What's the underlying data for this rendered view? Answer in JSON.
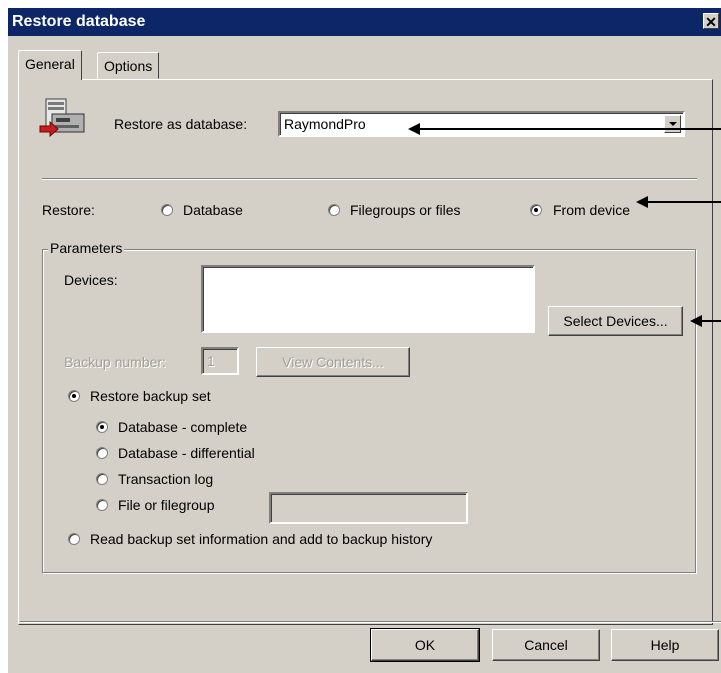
{
  "window": {
    "title": "Restore database",
    "close_glyph": "✕"
  },
  "tabs": [
    {
      "label": "General",
      "active": true
    },
    {
      "label": "Options",
      "active": false
    }
  ],
  "restore_as": {
    "icon": "database-server-icon",
    "label": "Restore as database:",
    "value": "RaymondPro"
  },
  "restore_mode": {
    "label": "Restore:",
    "options": [
      {
        "label": "Database",
        "selected": false
      },
      {
        "label": "Filegroups or files",
        "selected": false
      },
      {
        "label": "From device",
        "selected": true
      }
    ]
  },
  "parameters": {
    "legend": "Parameters",
    "devices_label": "Devices:",
    "select_devices_label": "Select Devices...",
    "backup_number_label": "Backup number:",
    "backup_number_value": "1",
    "view_contents_label": "View Contents...",
    "restore_backup_set_label": "Restore backup set",
    "backup_types": [
      {
        "label": "Database - complete",
        "selected": true
      },
      {
        "label": "Database - differential",
        "selected": false
      },
      {
        "label": "Transaction log",
        "selected": false
      },
      {
        "label": "File or filegroup",
        "selected": false
      }
    ],
    "read_backup_label": "Read backup set information and add to backup history"
  },
  "footer": {
    "ok": "OK",
    "cancel": "Cancel",
    "help": "Help"
  },
  "colors": {
    "titlebar": "#0c2668",
    "dialog_bg": "#d4d0c8"
  }
}
